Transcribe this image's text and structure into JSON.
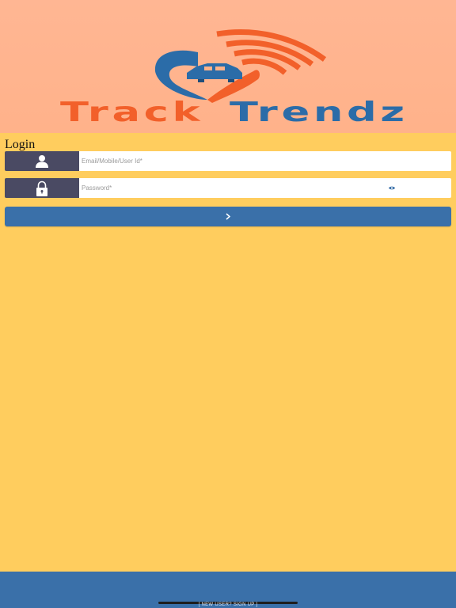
{
  "header": {
    "brand_part1": "Track",
    "brand_part2": "Trendz",
    "icons": [
      "car-location-pin-logo",
      "signal-waves-icon"
    ],
    "colors": {
      "orange": "#F2602A",
      "blue": "#2B6CA8",
      "background": "#FFB693"
    }
  },
  "login": {
    "title": "Login",
    "email": {
      "placeholder": "Email/Mobile/User Id*",
      "value": "",
      "icon": "user-icon"
    },
    "password": {
      "placeholder": "Password*",
      "value": "",
      "icon": "lock-icon",
      "toggle_icon": "eye-icon"
    },
    "submit_label": "›"
  },
  "footer": {
    "signup_label": "[ NEW USER? SIGN UP ]",
    "color": "#3A70A9"
  },
  "page": {
    "background": "#FFCD5E"
  }
}
